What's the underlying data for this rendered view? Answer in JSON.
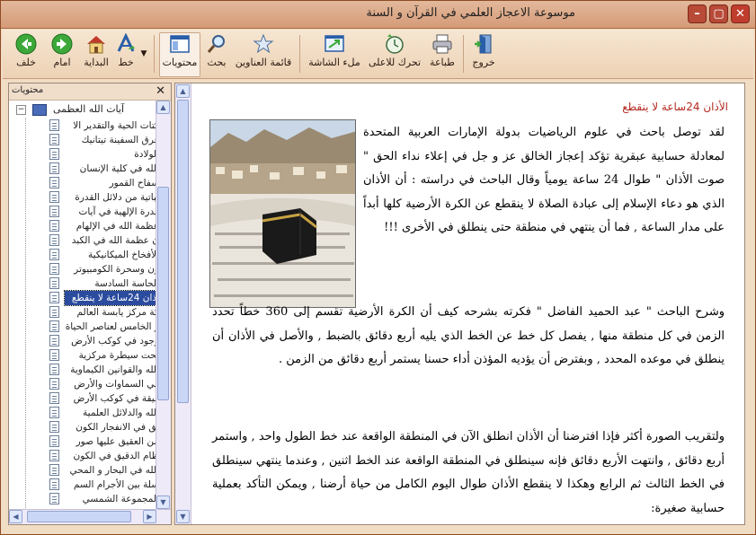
{
  "window": {
    "title": "موسوعة الاعجاز العلمي في القرآن و السنة"
  },
  "toolbar": {
    "back": "خلف",
    "forward": "امام",
    "home": "البداية",
    "font": "خط",
    "contents": "محتويات",
    "search": "بحث",
    "titles_list": "قائمة العناوين",
    "fullscreen": "ملء الشاشة",
    "move_up": "تحرك للاعلى",
    "print": "طباعة",
    "exit": "خروج"
  },
  "sidebar": {
    "title": "محتويات",
    "root": "آيات الله العظمى",
    "items": [
      "كتات الحية والتقدير الا",
      "غرق السفينة تيتانيك",
      "الولادة",
      "الله في كلية الإنسان",
      "سفاح القمور",
      "تباتية من دلائل القدرة",
      "قدرة الإلهية في آيات",
      "عظمة الله في الإلهام",
      "ن عظمة الله في الكبد",
      "الأفخاخ الميكانيكية",
      "ون وسحرة الكومبيوتر",
      "الحاسة السادسة",
      "أذان 24ساعة لا ينقطع",
      "كة مركز يابسة العالم",
      "ر الخامس لعناصر الحياة",
      "وجود في كوكب الأرض",
      "تحت سيطرة مركزية",
      "الله والقوانين الكيماوية",
      "في السماوات والأرض",
      "قيقة في كوكب الأرض",
      "الله والدلائل العلمية",
      "يق في الانفجار الكون",
      "من العقيق عليها صور",
      "ظام الدقيق في الكون",
      "الله في البحار و المحي",
      "سلة بين الأجرام السم",
      "المجموعة الشمسي"
    ],
    "selected_index": 12
  },
  "article": {
    "title": "الأذان 24ساعة لا ينقطع",
    "paragraphs": [
      "لقد توصل باحث في علوم الرياضيات بدولة الإمارات العربية المتحدة لمعادلة حسابية عبقرية تؤكد إعجاز الخالق عز و جل في إعلاء نداء الحق \" صوت الأذان \" طوال 24 ساعة يومياً وقال الباحث في دراسته : أن الأذان الذي هو دعاء الإسلام إلى عبادة الصلاة لا ينقطع عن الكرة الأرضية كلها أبداً على مدار الساعة , فما أن ينتهي في منطقة حتى ينطلق في الأخرى !!!",
      "وشرح الباحث \" عبد الحميد الفاضل \" فكرته بشرحه كيف أن الكرة الأرضية تقسم إلى 360 خطاً تحدد الزمن في كل منطقة منها , يفصل كل خط عن الخط الذي يليه أربع دقائق بالضبط , والأصل في الأذان أن ينطلق في موعده المحدد , وبفترض أن يؤديه المؤذن أداء حسنا يستمر أربع دقائق من الزمن .",
      "ولتقريب الصورة أكثر فإذا افترضنا أن الأذان انطلق الآن في المنطقة الواقعة عند خط الطول واحد , واستمر أربع دقائق , وانتهت الأربع دقائق فإنه سينطلق في المنطقة الواقعة عند الخط اثنين , وعندما ينتهي سينطلق في الخط الثالث ثم الرابع وهكذا لا ينقطع الأذان طوال اليوم الكامل من حياة أرضنا , ويمكن التأكد بعملية حسابية صغيرة:"
    ]
  },
  "colors": {
    "frame": "#c9815a",
    "accent_title": "#b3281e",
    "selection": "#2b4c9e"
  }
}
